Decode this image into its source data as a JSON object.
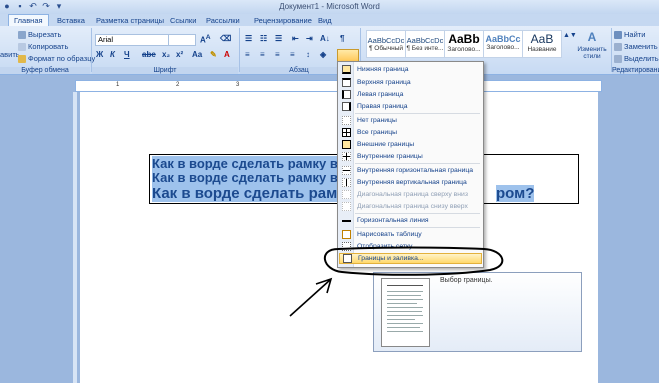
{
  "window": {
    "title": "Документ1 - Microsoft Word"
  },
  "tabs": [
    "Главная",
    "Вставка",
    "Разметка страницы",
    "Ссылки",
    "Рассылки",
    "Рецензирование",
    "Вид"
  ],
  "clipboard": {
    "paste_label": "авить",
    "cut": "Вырезать",
    "copy": "Копировать",
    "format_painter": "Формат по образцу",
    "group": "Буфер обмена"
  },
  "font": {
    "name": "Arial",
    "size": "",
    "group": "Шрифт"
  },
  "paragraph": {
    "group": "Абзац"
  },
  "styles": [
    {
      "sample": "AaBbCcDc",
      "name": "¶ Обычный"
    },
    {
      "sample": "AaBbCcDc",
      "name": "¶ Без инте..."
    },
    {
      "sample": "AaBb",
      "name": "Заголово..."
    },
    {
      "sample": "AaBbCc",
      "name": "Заголово..."
    },
    {
      "sample": "AaB",
      "name": "Название"
    }
  ],
  "editing": {
    "change_styles": "Изменить стили",
    "find": "Найти",
    "replace": "Заменить",
    "select": "Выделить",
    "group": "Редактирование"
  },
  "document": {
    "line1": "Как в ворде сделать рамку вок",
    "line2": "Как в ворде сделать рамку вок",
    "line3_a": "Как в ворде сделать рамк",
    "line3_b": "ром?"
  },
  "border_menu": [
    {
      "label": "Нижняя граница",
      "disabled": false
    },
    {
      "label": "Верхняя граница",
      "disabled": false
    },
    {
      "label": "Левая граница",
      "disabled": false
    },
    {
      "label": "Правая граница",
      "disabled": false
    },
    {
      "label": "Нет границы",
      "disabled": false
    },
    {
      "label": "Все границы",
      "disabled": false
    },
    {
      "label": "Внешние границы",
      "disabled": false
    },
    {
      "label": "Внутренние границы",
      "disabled": false
    },
    {
      "label": "Внутренняя горизонтальная граница",
      "disabled": false
    },
    {
      "label": "Внутренняя вертикальная граница",
      "disabled": false
    },
    {
      "label": "Диагональная граница сверху вниз",
      "disabled": true
    },
    {
      "label": "Диагональная граница снизу вверх",
      "disabled": true
    },
    {
      "label": "Горизонтальная линия",
      "disabled": false
    },
    {
      "label": "Нарисовать таблицу",
      "disabled": false
    },
    {
      "label": "Отобразить сетку",
      "disabled": false
    },
    {
      "label": "Границы и заливка...",
      "disabled": false
    }
  ],
  "tooltip": {
    "text": "Выбор границы."
  },
  "colors": {
    "accent": "#15428b",
    "highlight": "#ffd86b",
    "selection": "#9ec2ec"
  }
}
